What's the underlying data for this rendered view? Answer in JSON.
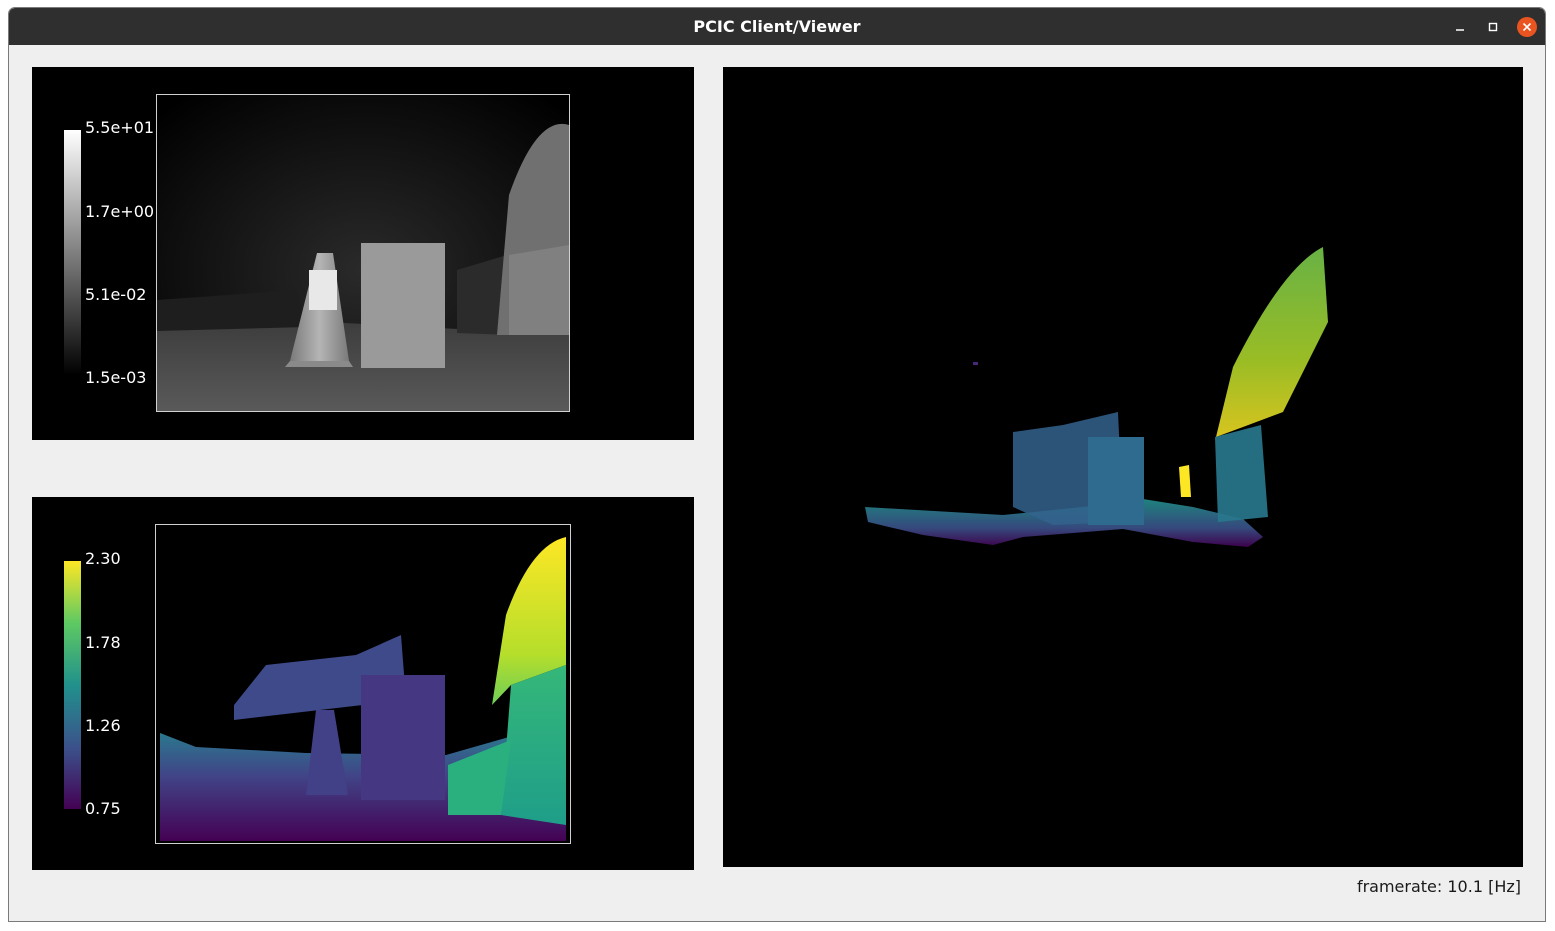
{
  "window": {
    "title": "PCIC Client/Viewer",
    "buttons": [
      "minimize-icon",
      "maximize-icon",
      "close-icon"
    ],
    "close_color": "#e95420"
  },
  "amplitude_view": {
    "colormap": "gray",
    "colorbar_ticks": [
      "5.5e+01",
      "1.7e+00",
      "5.1e-02",
      "1.5e-03"
    ]
  },
  "distance_view": {
    "colormap": "viridis",
    "colorbar_ticks": [
      "2.30",
      "1.78",
      "1.26",
      "0.75"
    ]
  },
  "point_cloud_view": {
    "colormap": "viridis"
  },
  "status": {
    "framerate": "framerate: 10.1 [Hz]"
  }
}
